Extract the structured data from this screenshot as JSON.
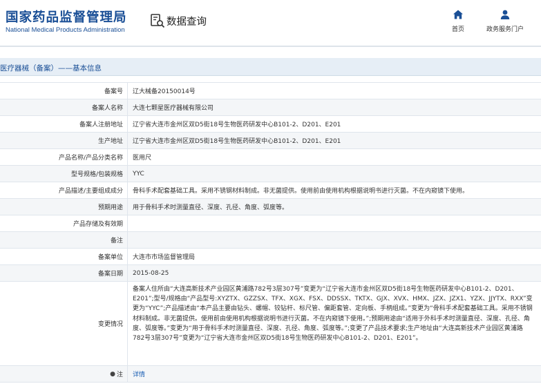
{
  "header": {
    "logo_cn": "国家药品监督管理局",
    "logo_en": "National Medical Products Administration",
    "query_label": "数据查询",
    "nav": [
      {
        "label": "首页",
        "icon": "home-icon"
      },
      {
        "label": "政务服务门户",
        "icon": "user-icon"
      }
    ]
  },
  "section": {
    "title": "医疗器械（备案）——基本信息"
  },
  "rows": [
    {
      "label": "备案号",
      "value": "辽大械备20150014号"
    },
    {
      "label": "备案人名称",
      "value": "大连七颗星医疗器械有限公司"
    },
    {
      "label": "备案人注册地址",
      "value": "辽宁省大连市金州区双D5街18号生物医药研发中心B101-2、D201、E201"
    },
    {
      "label": "生产地址",
      "value": "辽宁省大连市金州区双D5街18号生物医药研发中心B101-2、D201、E201"
    },
    {
      "label": "产品名称/产品分类名称",
      "value": "医用尺"
    },
    {
      "label": "型号规格/包装规格",
      "value": "YYC"
    },
    {
      "label": "产品描述/主要组成成分",
      "value": "骨科手术配套基础工具。采用不锈钢材料制成。非无菌提供。使用前由使用机构根据说明书进行灭菌。不在内窥镜下使用。"
    },
    {
      "label": "预期用途",
      "value": "用于骨科手术时测量直径、深度、孔径、角度、弧度等。"
    },
    {
      "label": "产品存储及有效期",
      "value": ""
    },
    {
      "label": "备注",
      "value": ""
    },
    {
      "label": "备案单位",
      "value": "大连市市场监督管理局"
    },
    {
      "label": "备案日期",
      "value": "2015-08-25"
    },
    {
      "label": "变更情况",
      "value": "备案人住所由“大连高新技术产业园区黄浦路782号3层307号”变更为“辽宁省大连市金州区双D5街18号生物医药研发中心B101-2、D201、E201”;型号/规格由“产品型号:XYZTX、GZZSX、TFX、XGX、FSX、DDSSX、TKTX、GJX、XVX、HMX、JZX、JZX1、YZX、JJYTX、RXX”变更为“YYC”;产品描述由“本产品主要由钻头、螺帽、铰钻杆、标尺管、偏距套管、定向板、手柄组成。”变更为“骨科手术配套基础工具。采用不锈钢材料制成。非无菌提供。使用前由使用机构根据说明书进行灭菌。不在内窥镜下使用。”;预期用途由“适用于外科手术时测量直径、深度、孔径、角度、弧度等。”变更为“用于骨科手术时测量直径、深度、孔径、角度、弧度等。”;变更了产品技术要求;生产地址由“大连高新技术产业园区黄浦路782号3层307号”变更为“辽宁省大连市金州区双D5街18号生物医药研发中心B101-2、D201、E201”。"
    },
    {
      "label": "注",
      "value": "详情"
    }
  ]
}
